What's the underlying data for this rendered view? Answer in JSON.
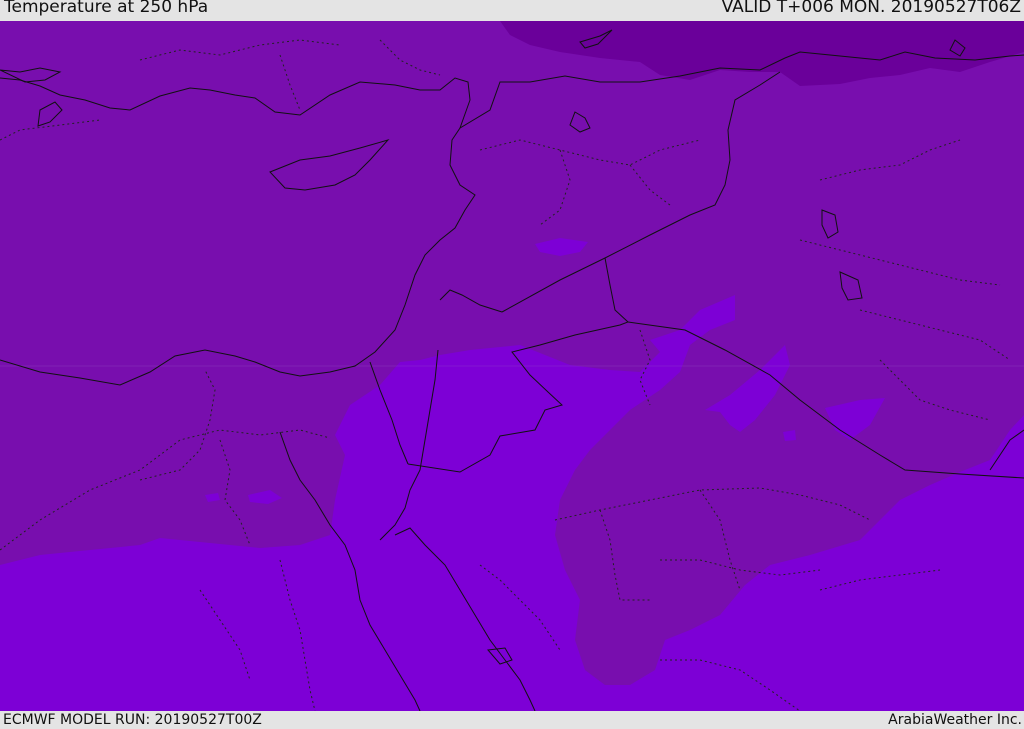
{
  "header": {
    "title": "Temperature at 250 hPa",
    "valid": "VALID T+006 MON. 20190527T06Z"
  },
  "footer": {
    "model_run": "ECMWF MODEL RUN: 20190527T00Z",
    "credit": "ArabiaWeather Inc."
  },
  "map": {
    "field": "temperature",
    "level": "250 hPa",
    "colors": {
      "deep_cold": "#6a009a",
      "cold": "#780eae",
      "warm": "#7d00d6",
      "coast": "#111111",
      "borders": "#222222"
    }
  }
}
